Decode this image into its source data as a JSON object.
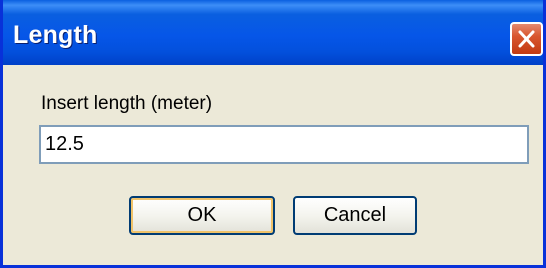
{
  "window": {
    "title": "Length",
    "close_icon": "close-icon",
    "titlebar_color": "#0a5fe0",
    "close_color": "#d9572f"
  },
  "dialog": {
    "prompt": "Insert length (meter)",
    "input_value": "12.5",
    "ok_label": "OK",
    "cancel_label": "Cancel"
  }
}
